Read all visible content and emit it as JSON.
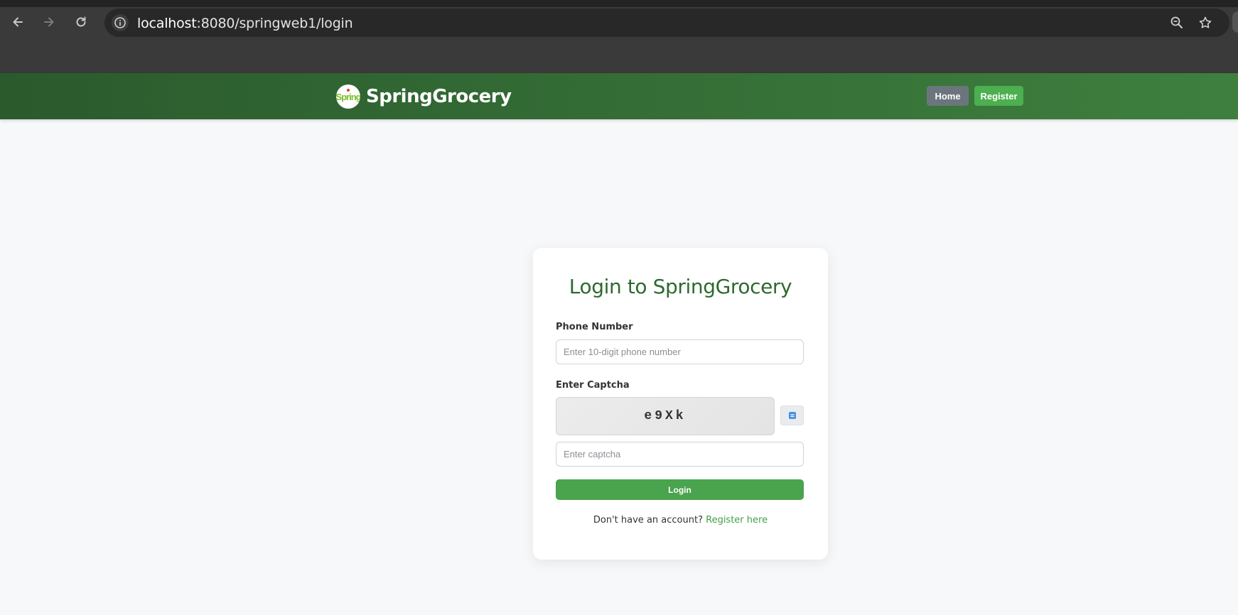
{
  "browser": {
    "url_host": "localhost",
    "url_rest": ":8080/springweb1/login"
  },
  "header": {
    "brand": "SpringGrocery",
    "logo_text": "Spring",
    "nav": {
      "home": "Home",
      "register": "Register"
    }
  },
  "login": {
    "title": "Login to SpringGrocery",
    "phone_label": "Phone Number",
    "phone_placeholder": "Enter 10-digit phone number",
    "phone_value": "",
    "captcha_label": "Enter Captcha",
    "captcha_code": "e9Xk",
    "captcha_placeholder": "Enter captcha",
    "captcha_value": "",
    "submit_label": "Login",
    "footer_text": "Don't have an account?",
    "footer_link": "Register here"
  },
  "colors": {
    "header_gradient_start": "#2b5a2d",
    "header_gradient_end": "#3e7f3e",
    "title_green": "#2d6a2f",
    "login_button": "#4aa34d",
    "home_button": "#6c757d",
    "register_button": "#4caf50",
    "link_green": "#43a047"
  },
  "icons": {
    "back": "arrow-left-icon",
    "forward": "arrow-right-icon",
    "reload": "reload-icon",
    "site_info": "info-icon",
    "zoom": "zoom-out-icon",
    "bookmark": "star-icon",
    "captcha_refresh": "refresh-icon"
  }
}
